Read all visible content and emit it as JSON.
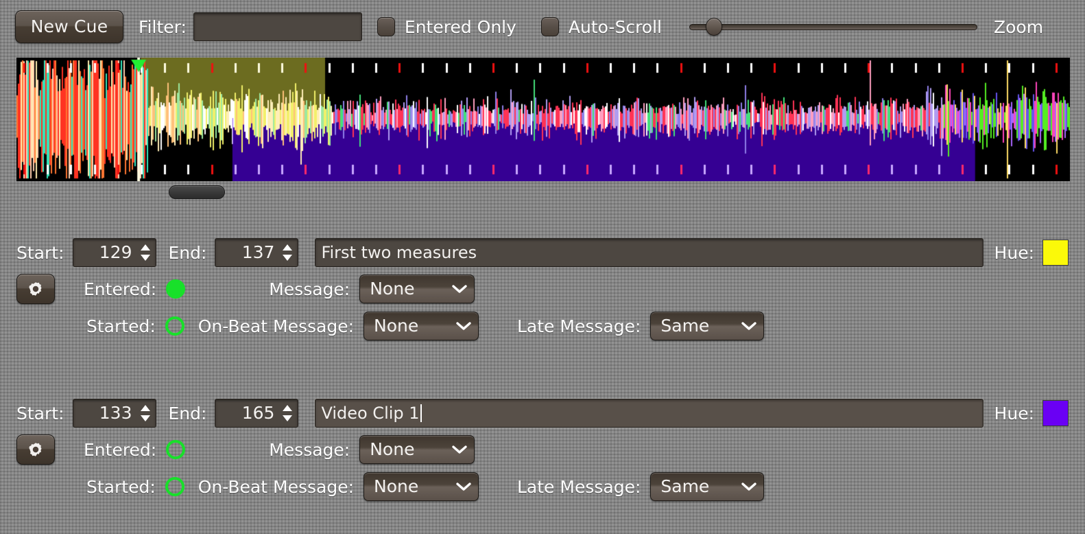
{
  "toolbar": {
    "new_cue_label": "New Cue",
    "filter_label": "Filter:",
    "filter_value": "",
    "filter_placeholder": "",
    "entered_only_label": "Entered Only",
    "entered_only_checked": false,
    "auto_scroll_label": "Auto-Scroll",
    "auto_scroll_checked": false,
    "zoom_label": "Zoom",
    "zoom_slider_position_pct": 6
  },
  "waveform": {
    "background_color": "#000000",
    "playhead_color": "#22ee33",
    "playhead_x_pct": 11.6,
    "cue_overlays": [
      {
        "name": "First two measures",
        "hue": "#d8d840",
        "start_pct": 11.8,
        "end_pct": 29.3,
        "half": "top"
      },
      {
        "name": "Video Clip 1",
        "hue": "#5500ee",
        "start_pct": 20.5,
        "end_pct": 91.0,
        "half": "bottom"
      }
    ],
    "beat_marker_colors": {
      "downbeat": "#ee1111",
      "beat": "#ffffff"
    }
  },
  "cues": [
    {
      "start_label": "Start:",
      "start_value": "129",
      "end_label": "End:",
      "end_value": "137",
      "name": "First two measures",
      "name_focused": false,
      "hue_label": "Hue:",
      "hue_color": "#fbf909",
      "gear_icon": "gear-icon",
      "entered_label": "Entered:",
      "entered_on": true,
      "message_label": "Message:",
      "message_value": "None",
      "started_label": "Started:",
      "started_on": false,
      "onbeat_label": "On-Beat Message:",
      "onbeat_value": "None",
      "late_label": "Late Message:",
      "late_value": "Same"
    },
    {
      "start_label": "Start:",
      "start_value": "133",
      "end_label": "End:",
      "end_value": "165",
      "name": "Video Clip 1",
      "name_focused": true,
      "hue_label": "Hue:",
      "hue_color": "#6a00f4",
      "gear_icon": "gear-icon",
      "entered_label": "Entered:",
      "entered_on": false,
      "message_label": "Message:",
      "message_value": "None",
      "started_label": "Started:",
      "started_on": false,
      "onbeat_label": "On-Beat Message:",
      "onbeat_value": "None",
      "late_label": "Late Message:",
      "late_value": "Same"
    }
  ]
}
